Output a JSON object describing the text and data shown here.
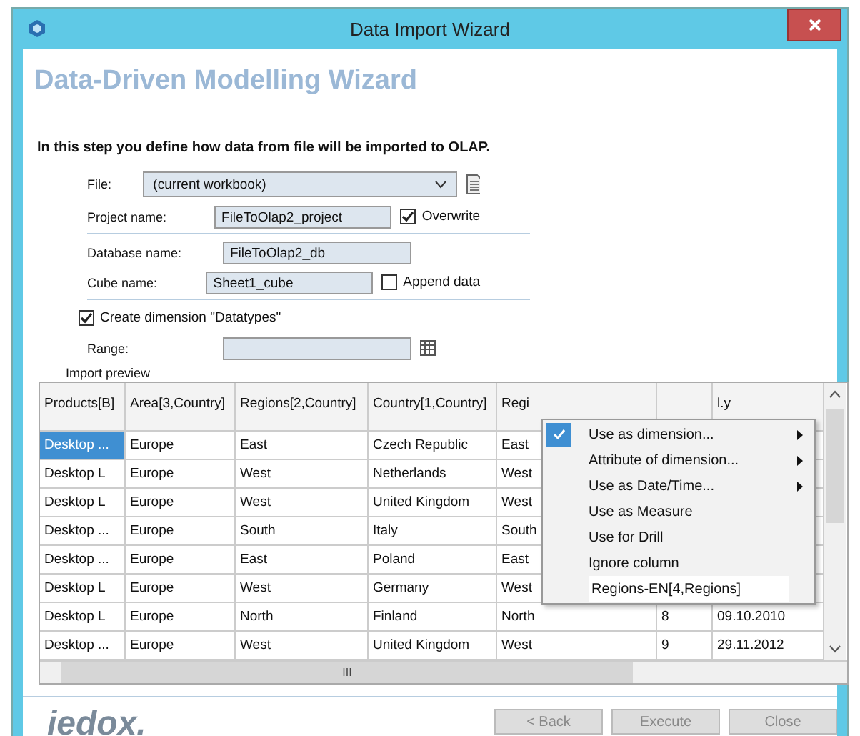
{
  "window": {
    "title": "Data Import Wizard"
  },
  "heading": "Data-Driven Modelling Wizard",
  "intro": "In this step you define how data from file will be imported to OLAP.",
  "file": {
    "label": "File:",
    "value": "(current workbook)"
  },
  "project": {
    "label": "Project name:",
    "value": "FileToOlap2_project",
    "option": {
      "label": "Overwrite",
      "checked": true
    }
  },
  "database": {
    "label": "Database name:",
    "value": "FileToOlap2_db"
  },
  "cube": {
    "label": "Cube name:",
    "value": "Sheet1_cube",
    "option": {
      "label": "Append data",
      "checked": false
    }
  },
  "create_dimension": {
    "label": "Create dimension \"Datatypes\"",
    "checked": true
  },
  "range": {
    "label": "Range:"
  },
  "preview": {
    "label": "Import preview",
    "columns": [
      "Products[B]",
      "Area[3,Country]",
      "Regions[2,Country]",
      "Country[1,Country]",
      "Regi",
      "",
      "l.y"
    ],
    "rows": [
      {
        "selected": true,
        "cells": [
          "Desktop ...",
          "Europe",
          "East",
          "Czech Republic",
          "East",
          "",
          ""
        ]
      },
      {
        "selected": false,
        "cells": [
          "Desktop L",
          "Europe",
          "West",
          "Netherlands",
          "West",
          "",
          ""
        ]
      },
      {
        "selected": false,
        "cells": [
          "Desktop L",
          "Europe",
          "West",
          "United Kingdom",
          "West",
          "",
          ""
        ]
      },
      {
        "selected": false,
        "cells": [
          "Desktop ...",
          "Europe",
          "South",
          "Italy",
          "South",
          "",
          ""
        ]
      },
      {
        "selected": false,
        "cells": [
          "Desktop ...",
          "Europe",
          "East",
          "Poland",
          "East",
          "",
          ""
        ]
      },
      {
        "selected": false,
        "cells": [
          "Desktop L",
          "Europe",
          "West",
          "Germany",
          "West",
          "",
          ""
        ]
      },
      {
        "selected": false,
        "cells": [
          "Desktop L",
          "Europe",
          "North",
          "Finland",
          "North",
          "8",
          "09.10.2010"
        ]
      },
      {
        "selected": false,
        "cells": [
          "Desktop ...",
          "Europe",
          "West",
          "United Kingdom",
          "West",
          "9",
          "29.11.2012"
        ]
      }
    ],
    "hscroll_thumb": "III"
  },
  "context_menu": [
    {
      "kind": "item",
      "label": "Use as dimension...",
      "checked": true,
      "submenu": true
    },
    {
      "kind": "item",
      "label": "Attribute of dimension...",
      "checked": false,
      "submenu": true
    },
    {
      "kind": "item",
      "label": "Use as Date/Time...",
      "checked": false,
      "submenu": true
    },
    {
      "kind": "item",
      "label": "Use as Measure",
      "checked": false,
      "submenu": false
    },
    {
      "kind": "item",
      "label": "Use for Drill",
      "checked": false,
      "submenu": false
    },
    {
      "kind": "item",
      "label": "Ignore column",
      "checked": false,
      "submenu": false
    },
    {
      "kind": "input",
      "value": "Regions-EN[4,Regions]"
    }
  ],
  "logo": "iedox.",
  "buttons": [
    {
      "label": "< Back",
      "disabled": true
    },
    {
      "label": "Execute",
      "disabled": true
    },
    {
      "label": "Close",
      "disabled": true
    }
  ]
}
